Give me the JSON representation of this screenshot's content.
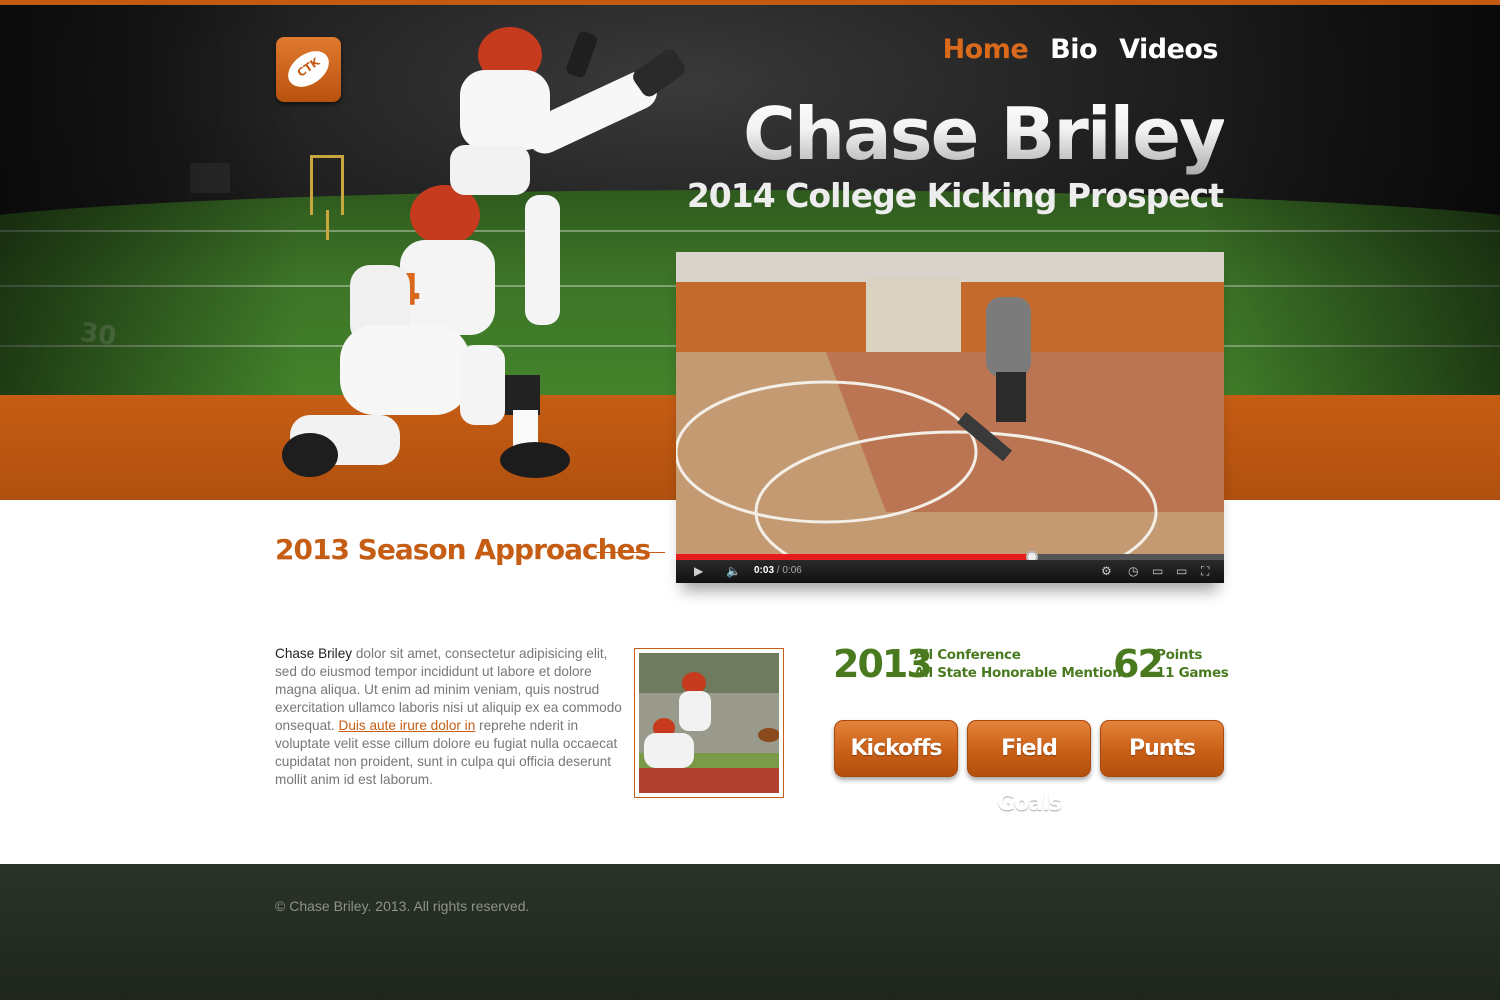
{
  "brand": {
    "logo_text": "CTK"
  },
  "nav": {
    "items": [
      {
        "label": "Home",
        "active": true
      },
      {
        "label": "Bio",
        "active": false
      },
      {
        "label": "Videos",
        "active": false
      }
    ]
  },
  "hero": {
    "title": "Chase Briley",
    "subtitle": "2014 College Kicking Prospect",
    "jersey_number": "34",
    "yard_marker": "30"
  },
  "video": {
    "current_time": "0:03",
    "duration": "0:06",
    "progress_percent": 65
  },
  "section": {
    "title": "2013 Season Approaches"
  },
  "article": {
    "lead": "Chase Briley",
    "text_before_link": " dolor sit amet, consectetur adipisicing elit, sed do eiusmod tempor incididunt ut labore et dolore magna aliqua. Ut enim ad minim veniam, quis nostrud exercitation ullamco laboris nisi ut aliquip ex ea commodo onsequat. ",
    "link_text": "Duis aute irure dolor in",
    "text_after_link": " reprehe nderit in voluptate velit esse cillum dolore eu fugiat nulla occaecat cupidatat non proident, sunt in culpa qui officia deserunt mollit anim id est laborum."
  },
  "stats": {
    "year": "2013",
    "honors": [
      "All Conference",
      "All State Honorable Mention"
    ],
    "points_value": "62",
    "points_lines": [
      "Points",
      "11 Games"
    ]
  },
  "buttons": {
    "kickoffs": "Kickoffs",
    "field_goals": "Field Goals",
    "punts": "Punts"
  },
  "footer": {
    "copyright": "© Chase Briley. 2013. All rights reserved."
  },
  "colors": {
    "accent": "#c65d14",
    "green": "#4a7a1f",
    "footer_bg": "#252d22"
  }
}
